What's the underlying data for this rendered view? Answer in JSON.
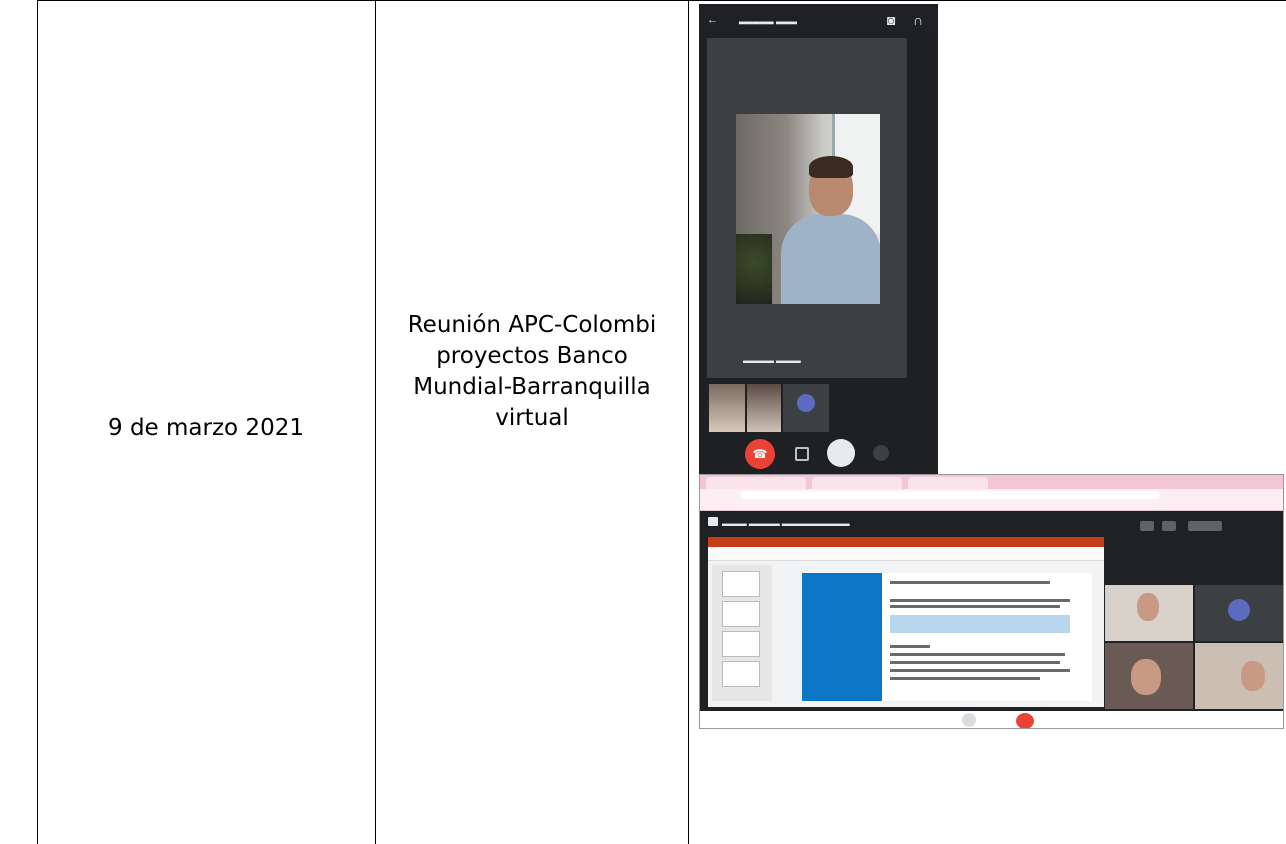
{
  "row": {
    "date": "9 de marzo 2021",
    "description_lines": [
      "Reunión APC-Colombi",
      "proyectos Banco",
      "Mundial-Barranquilla",
      "virtual"
    ]
  },
  "evidence": {
    "phone_call": {
      "screenshot_icons": [
        "back-arrow-icon",
        "camera-switch-icon",
        "headphones-icon"
      ]
    },
    "desktop_meeting": {
      "screenshot_icons": [
        "meet-icon",
        "end-call-icon",
        "microphone-icon"
      ]
    }
  }
}
